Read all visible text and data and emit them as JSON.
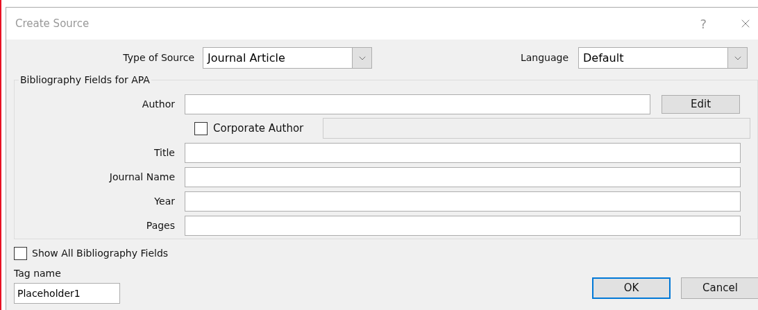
{
  "window": {
    "title": "Create Source",
    "help": "?"
  },
  "type_of_source": {
    "label": "Type of Source",
    "value": "Journal Article"
  },
  "language": {
    "label": "Language",
    "value": "Default"
  },
  "group": {
    "legend": "Bibliography Fields for APA",
    "author_label": "Author",
    "edit_button": "Edit",
    "corporate_author": {
      "label": "Corporate Author",
      "checked": false,
      "field_disabled": true
    },
    "fields": [
      {
        "label": "Title"
      },
      {
        "label": "Journal Name"
      },
      {
        "label": "Year"
      },
      {
        "label": "Pages"
      }
    ]
  },
  "show_all": {
    "label": "Show All Bibliography Fields",
    "checked": false
  },
  "tag_name": {
    "label": "Tag name",
    "value": "Placeholder1"
  },
  "buttons": [
    {
      "label": "OK",
      "default": true
    },
    {
      "label": "Cancel",
      "default": false
    }
  ]
}
